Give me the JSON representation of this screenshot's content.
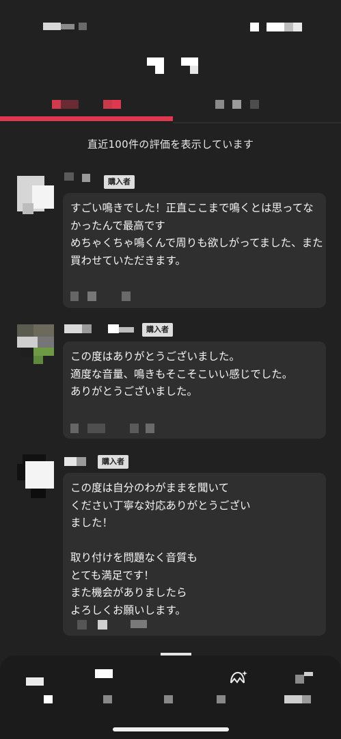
{
  "notice": "直近100件の評価を表示しています",
  "badge_label": "購入者",
  "reviews": [
    {
      "comment": "すごい鳴きでした！正直ここまで鳴くとは思ってなかったんで最高です\nめちゃくちゃ鳴くんで周りも欲しがってました、また買わせていただきます。"
    },
    {
      "comment": "この度はありがとうございました。\n適度な音量、鳴きもそこそこいい感じでした。\nありがとうございました。"
    },
    {
      "comment": "この度は自分のわがままを聞いて\nください丁寧な対応ありがとうござい\nました！\n\n取り付けを問題なく音質も\nとても満足です！\nまた機会がありましたら\nよろしくお願いします。"
    }
  ],
  "bottom_nav": {
    "items": [
      "home",
      "search",
      "sell",
      "notifications",
      "account"
    ]
  },
  "colors": {
    "background": "#212121",
    "accent": "#e0384f",
    "bubble": "#2f2f2f",
    "badge": "#dedede"
  }
}
